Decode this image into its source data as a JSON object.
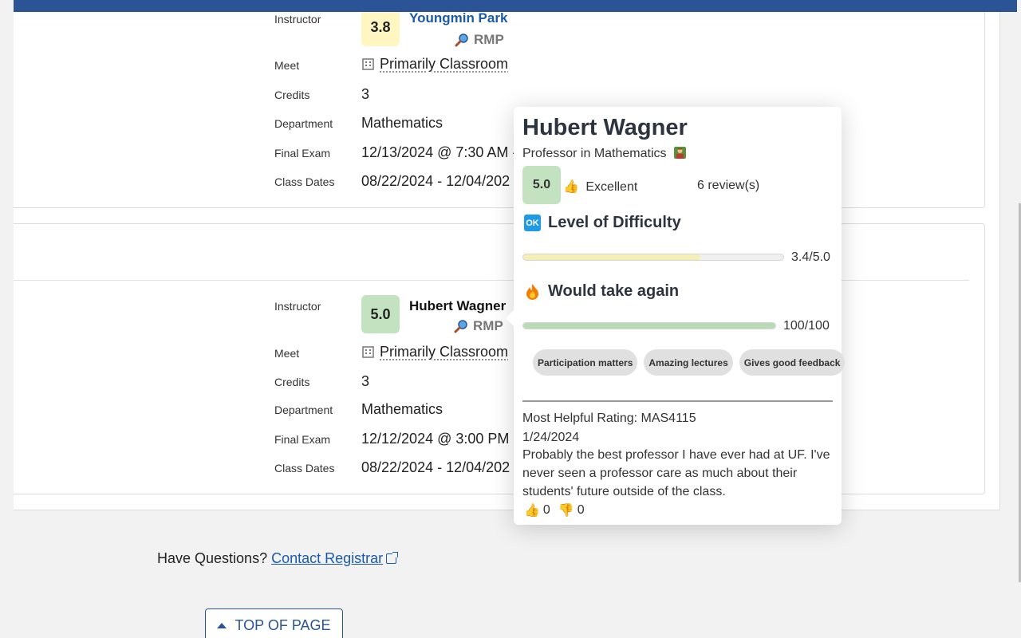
{
  "course_a": {
    "instructor_label": "Instructor",
    "rating": "3.8",
    "rating_color": "#fff6c2",
    "instructor_name": "Youngmin Park",
    "rmp_label": "RMP",
    "meet_label": "Meet",
    "meet_value": "Primarily Classroom",
    "credits_label": "Credits",
    "credits_value": "3",
    "department_label": "Department",
    "department_value": "Mathematics",
    "final_exam_label": "Final Exam",
    "final_exam_value": "12/13/2024 @ 7:30 AM -",
    "class_dates_label": "Class Dates",
    "class_dates_value": "08/22/2024 - 12/04/202"
  },
  "course_b": {
    "instructor_label": "Instructor",
    "rating": "5.0",
    "rating_color": "#c3e3c0",
    "instructor_name": "Hubert Wagner",
    "rmp_label": "RMP",
    "meet_label": "Meet",
    "meet_value": "Primarily Classroom",
    "credits_label": "Credits",
    "credits_value": "3",
    "department_label": "Department",
    "department_value": "Mathematics",
    "final_exam_label": "Final Exam",
    "final_exam_value": "12/12/2024 @ 3:00 PM -",
    "class_dates_label": "Class Dates",
    "class_dates_value": "08/22/2024 - 12/04/202"
  },
  "popup": {
    "name": "Hubert Wagner",
    "subtitle": "Professor in Mathematics",
    "score": "5.0",
    "quality": "Excellent",
    "reviews": "6 review(s)",
    "difficulty_title": "Level of Difficulty",
    "difficulty_icon": "OK",
    "difficulty_fraction": 0.68,
    "difficulty_value": "3.4/5.0",
    "take_again_title": "Would take again",
    "take_again_fraction": 1.0,
    "take_again_value": "100/100",
    "tags": [
      "Participation matters",
      "Amazing lectures",
      "Gives good feedback"
    ],
    "helpful_label": "Most Helpful Rating: MAS4115",
    "helpful_date": "1/24/2024",
    "comment": "Probably the best professor I have ever had at UF. I've never seen a professor care as much about their students' future outside of the class.",
    "thumbs_up": "0",
    "thumbs_down": "0"
  },
  "footer": {
    "questions_text": "Have Questions?",
    "contact_link": "Contact Registrar",
    "top_button": "TOP OF PAGE"
  },
  "colors": {
    "header_blue": "#2a5496",
    "link_blue": "#1b5aa8",
    "difficulty_bar": "#f3efb5",
    "take_again_bar": "#b8dbb5"
  },
  "icons": [
    "magnifier-icon",
    "building-icon",
    "teacher-icon",
    "thumbs-up-icon",
    "thumbs-down-icon",
    "ok-icon",
    "fire-icon",
    "external-link-icon",
    "caret-up-icon"
  ]
}
